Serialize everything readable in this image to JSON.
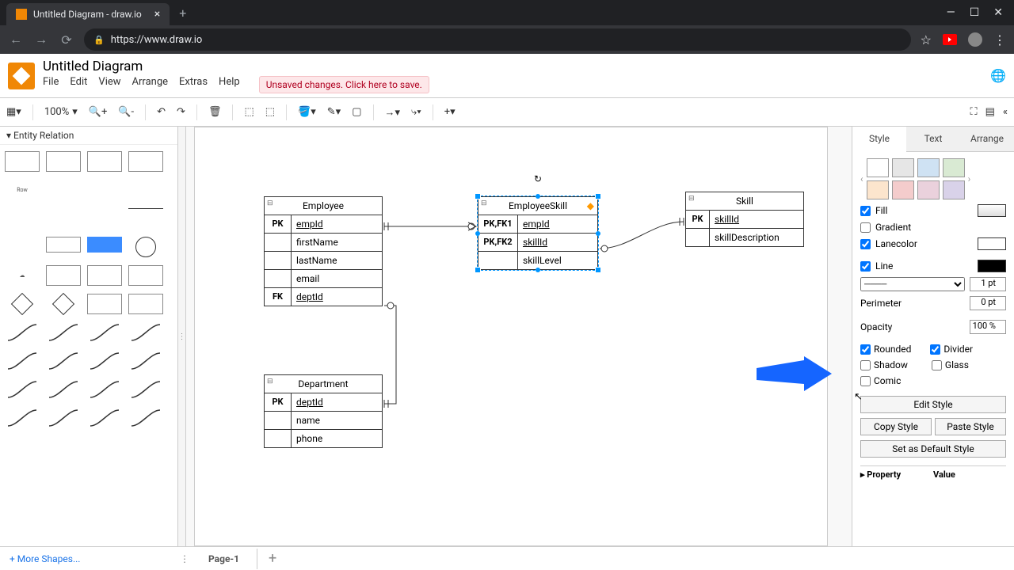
{
  "browser": {
    "tab_title": "Untitled Diagram - draw.io",
    "url": "https://www.draw.io"
  },
  "app": {
    "doc_title": "Untitled Diagram",
    "menu": [
      "File",
      "Edit",
      "View",
      "Arrange",
      "Extras",
      "Help"
    ],
    "unsaved_msg": "Unsaved changes. Click here to save."
  },
  "toolbar": {
    "zoom": "100%"
  },
  "sidebar_left": {
    "section": "Entity Relation",
    "row_label": "Row",
    "more_shapes": "+ More Shapes..."
  },
  "canvas": {
    "entities": {
      "employee": {
        "title": "Employee",
        "rows": [
          [
            "PK",
            "empId"
          ],
          [
            "",
            "firstName"
          ],
          [
            "",
            "lastName"
          ],
          [
            "",
            "email"
          ],
          [
            "FK",
            "deptId"
          ]
        ]
      },
      "department": {
        "title": "Department",
        "rows": [
          [
            "PK",
            "deptId"
          ],
          [
            "",
            "name"
          ],
          [
            "",
            "phone"
          ]
        ]
      },
      "employeeSkill": {
        "title": "EmployeeSkill",
        "rows": [
          [
            "PK,FK1",
            "empId"
          ],
          [
            "PK,FK2",
            "skillId"
          ],
          [
            "",
            "skillLevel"
          ]
        ]
      },
      "skill": {
        "title": "Skill",
        "rows": [
          [
            "PK",
            "skillId"
          ],
          [
            "",
            "skillDescription"
          ]
        ]
      }
    }
  },
  "right_panel": {
    "tabs": [
      "Style",
      "Text",
      "Arrange"
    ],
    "fill_label": "Fill",
    "gradient_label": "Gradient",
    "lanecolor_label": "Lanecolor",
    "line_label": "Line",
    "line_width": "1 pt",
    "perimeter_label": "Perimeter",
    "perimeter_val": "0 pt",
    "opacity_label": "Opacity",
    "opacity_val": "100 %",
    "rounded": "Rounded",
    "divider": "Divider",
    "shadow": "Shadow",
    "glass": "Glass",
    "comic": "Comic",
    "edit_style": "Edit Style",
    "copy_style": "Copy Style",
    "paste_style": "Paste Style",
    "set_default": "Set as Default Style",
    "prop_header": "Property",
    "val_header": "Value",
    "swatches": [
      "#ffffff",
      "#e6e6e6",
      "#cfe2f3",
      "#d9ead3",
      "#fce5cd",
      "#f4cccc",
      "#ead1dc",
      "#d9d2e9"
    ]
  },
  "pages": {
    "page1": "Page-1"
  }
}
